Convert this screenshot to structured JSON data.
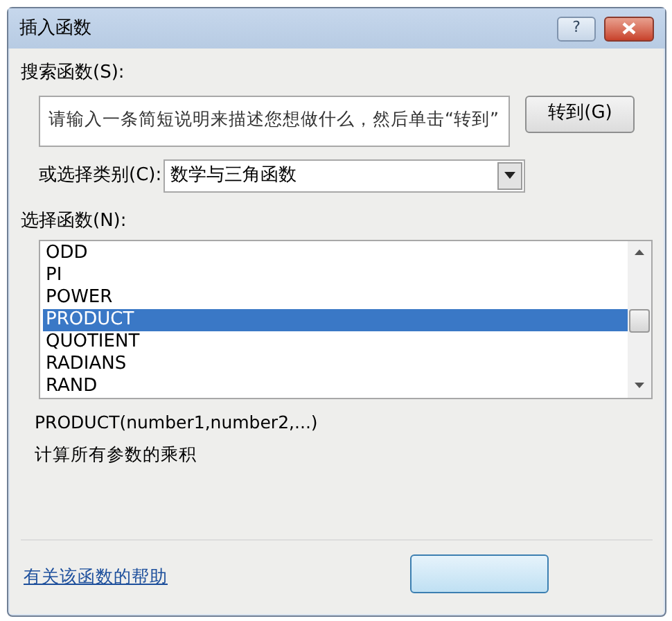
{
  "window": {
    "title": "插入函数",
    "help_button": "?"
  },
  "search": {
    "label": "搜索函数(S):",
    "placeholder": "请输入一条简短说明来描述您想做什么，然后单击“转到”",
    "go_button": "转到(G)"
  },
  "category": {
    "label": "或选择类别(C):",
    "value": "数学与三角函数"
  },
  "functions": {
    "label": "选择函数(N):",
    "items": [
      {
        "name": "ODD",
        "selected": false
      },
      {
        "name": "PI",
        "selected": false
      },
      {
        "name": "POWER",
        "selected": false
      },
      {
        "name": "PRODUCT",
        "selected": true
      },
      {
        "name": "QUOTIENT",
        "selected": false
      },
      {
        "name": "RADIANS",
        "selected": false
      },
      {
        "name": "RAND",
        "selected": false
      }
    ]
  },
  "signature": "PRODUCT(number1,number2,...)",
  "description": "计算所有参数的乘积",
  "help_link": "有关该函数的帮助"
}
